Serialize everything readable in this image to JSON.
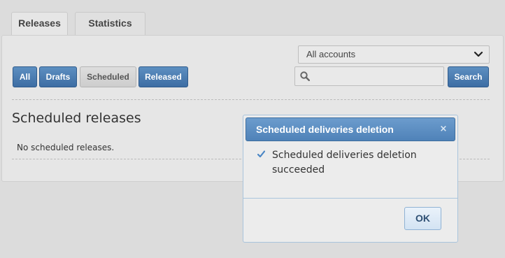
{
  "tabs": [
    {
      "label": "Releases",
      "active": true
    },
    {
      "label": "Statistics",
      "active": false
    }
  ],
  "filters": {
    "all": "All",
    "drafts": "Drafts",
    "scheduled": "Scheduled",
    "released": "Released",
    "selected": "Scheduled"
  },
  "accounts": {
    "selected": "All accounts"
  },
  "search": {
    "value": "",
    "placeholder": "",
    "button": "Search"
  },
  "section": {
    "title": "Scheduled releases",
    "empty_message": "No scheduled releases."
  },
  "modal": {
    "title": "Scheduled deliveries deletion",
    "close_glyph": "×",
    "message": "Scheduled deliveries deletion succeeded",
    "ok": "OK"
  },
  "colors": {
    "primary_button": "#4a7bb0",
    "modal_header": "#5d8fc1",
    "check": "#4a86c5"
  }
}
